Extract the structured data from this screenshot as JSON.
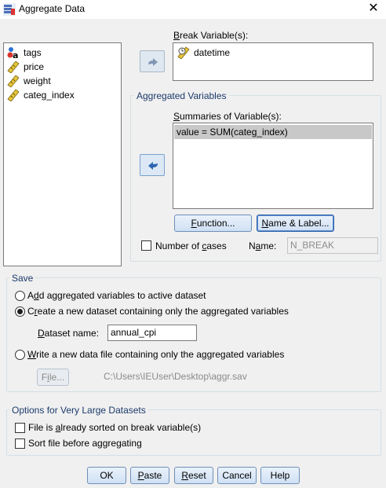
{
  "window": {
    "title": "Aggregate Data",
    "close_glyph": "✕"
  },
  "variables": [
    {
      "name": "tags",
      "icon": "nominal-variable-icon"
    },
    {
      "name": "price",
      "icon": "scale-variable-icon"
    },
    {
      "name": "weight",
      "icon": "scale-variable-icon"
    },
    {
      "name": "categ_index",
      "icon": "scale-variable-icon"
    }
  ],
  "break": {
    "label": "Break Variable(s):",
    "label_u": "B",
    "label_rest": "reak Variable(s):",
    "items": [
      {
        "name": "datetime",
        "icon": "date-variable-icon"
      }
    ]
  },
  "aggregated": {
    "title": "Aggregated Variables",
    "summaries_label_u": "S",
    "summaries_label_rest": "ummaries of Variable(s):",
    "items": [
      "value = SUM(categ_index)"
    ],
    "function_button": {
      "u": "F",
      "rest": "unction..."
    },
    "name_label_button": {
      "u": "N",
      "rest": "ame & Label..."
    },
    "number_of_cases_pre": "Number of ",
    "number_of_cases_u": "c",
    "number_of_cases_post": "ases",
    "name_field_label_pre": "N",
    "name_field_label_u": "a",
    "name_field_label_post": "me:",
    "name_field_value": "N_BREAK"
  },
  "save": {
    "title": "Save",
    "opt1_pre": "A",
    "opt1_u": "d",
    "opt1_post": "d aggregated variables to active dataset",
    "opt2_pre": "C",
    "opt2_u": "r",
    "opt2_post": "eate a new dataset containing only the aggregated variables",
    "dataset_name_pre": "",
    "dataset_name_u": "D",
    "dataset_name_post": "ataset name:",
    "dataset_name_value": "annual_cpi",
    "opt3_pre": "",
    "opt3_u": "W",
    "opt3_post": "rite a new data file containing only the aggregated variables",
    "file_button_pre": "F",
    "file_button_u": "i",
    "file_button_post": "le...",
    "file_path": "C:\\Users\\IEUser\\Desktop\\aggr.sav",
    "selected": 2
  },
  "large": {
    "title": "Options for Very Large Datasets",
    "sorted_pre": "File is ",
    "sorted_u": "a",
    "sorted_post": "lready sorted on break variable(s)",
    "sort_before": "Sort file before aggregating"
  },
  "buttons": {
    "ok": "OK",
    "paste_u": "P",
    "paste_rest": "aste",
    "reset_u": "R",
    "reset_rest": "eset",
    "cancel": "Cancel",
    "help": "Help"
  }
}
